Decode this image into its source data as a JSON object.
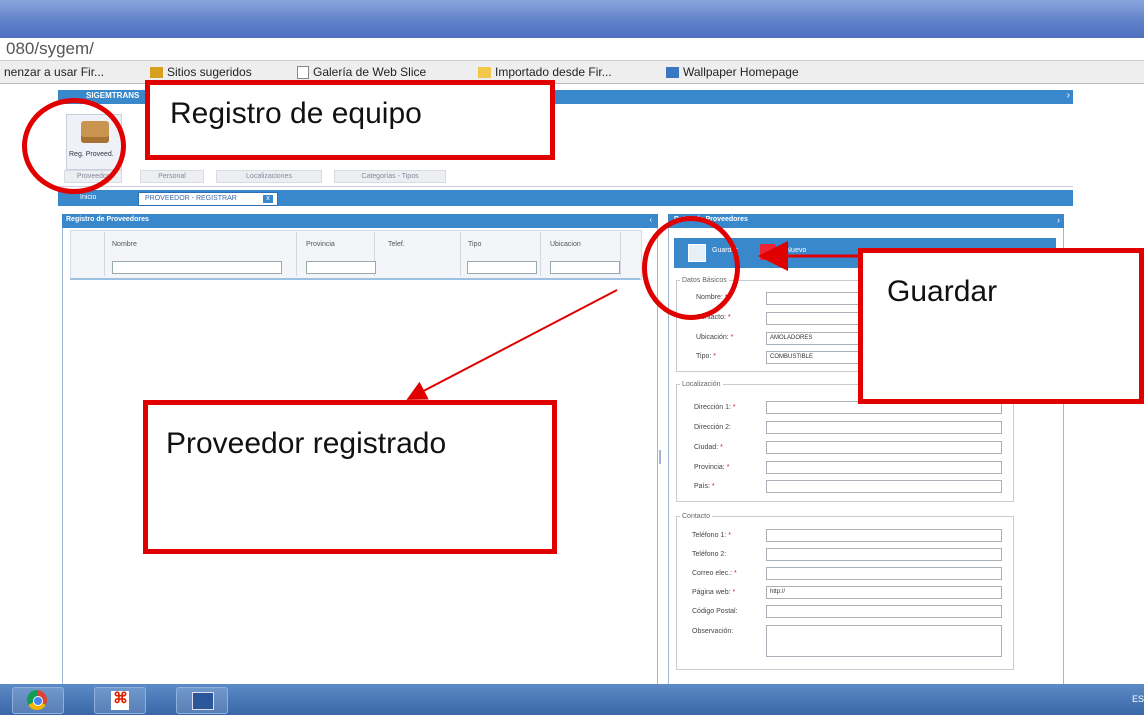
{
  "browser": {
    "address": "080/sygem/",
    "bookmarks": [
      {
        "label": "nenzar a usar Fir...",
        "icon": "none"
      },
      {
        "label": "Sitios sugeridos",
        "icon": "suggested-sites-icon"
      },
      {
        "label": "Galería de Web Slice",
        "icon": "page-icon"
      },
      {
        "label": "Importado desde Fir...",
        "icon": "folder-icon"
      },
      {
        "label": "Wallpaper Homepage",
        "icon": "wallpaper-icon"
      }
    ]
  },
  "app": {
    "header_title": "SIGEMTRANS",
    "ribbon_button": "Reg. Proveed.",
    "ribbon_tabs": [
      "Proveedor",
      "Personal",
      "Localizaciones",
      "Categorías - Tipos"
    ],
    "tabs": {
      "home": "Inicio",
      "active": "PROVEEDOR - REGISTRAR",
      "close": "x"
    }
  },
  "left_panel": {
    "title": "Registro de Proveedores",
    "columns": [
      "Nombre",
      "Provincia",
      "Telef.",
      "Tipo",
      "Ubicacion"
    ]
  },
  "right_panel": {
    "title": "Datos de Proveedores",
    "toolbar": {
      "save": "Guardar",
      "new": "Nuevo"
    },
    "sections": {
      "basic": {
        "legend": "Datos Básicos",
        "fields": [
          {
            "label": "Nombre:",
            "value": ""
          },
          {
            "label": "Contacto:",
            "value": ""
          },
          {
            "label": "Ubicación:",
            "value": "AMOLADORES"
          },
          {
            "label": "Tipo:",
            "value": "COMBUSTIBLE"
          }
        ]
      },
      "location": {
        "legend": "Localización",
        "fields": [
          {
            "label": "Dirección 1:",
            "value": ""
          },
          {
            "label": "Dirección 2:",
            "value": ""
          },
          {
            "label": "Ciudad:",
            "value": ""
          },
          {
            "label": "Provincia:",
            "value": ""
          },
          {
            "label": "País:",
            "value": ""
          }
        ]
      },
      "contact": {
        "legend": "Contacto",
        "fields": [
          {
            "label": "Teléfono 1:",
            "value": ""
          },
          {
            "label": "Teléfono 2:",
            "value": ""
          },
          {
            "label": "Correo elec.:",
            "value": ""
          },
          {
            "label": "Página web:",
            "value": "http://"
          },
          {
            "label": "Código Postal:",
            "value": ""
          },
          {
            "label": "Observación:",
            "value": ""
          }
        ]
      }
    }
  },
  "taskbar": {
    "tray": "ES",
    "apps": [
      "chrome-icon",
      "pdf-icon",
      "word-icon"
    ]
  },
  "annotations": {
    "registro": "Registro de equipo",
    "guardar": "Guardar",
    "proveedor": "Proveedor registrado"
  },
  "colors": {
    "accent": "#3a88cc",
    "annotation": "#e00000"
  }
}
